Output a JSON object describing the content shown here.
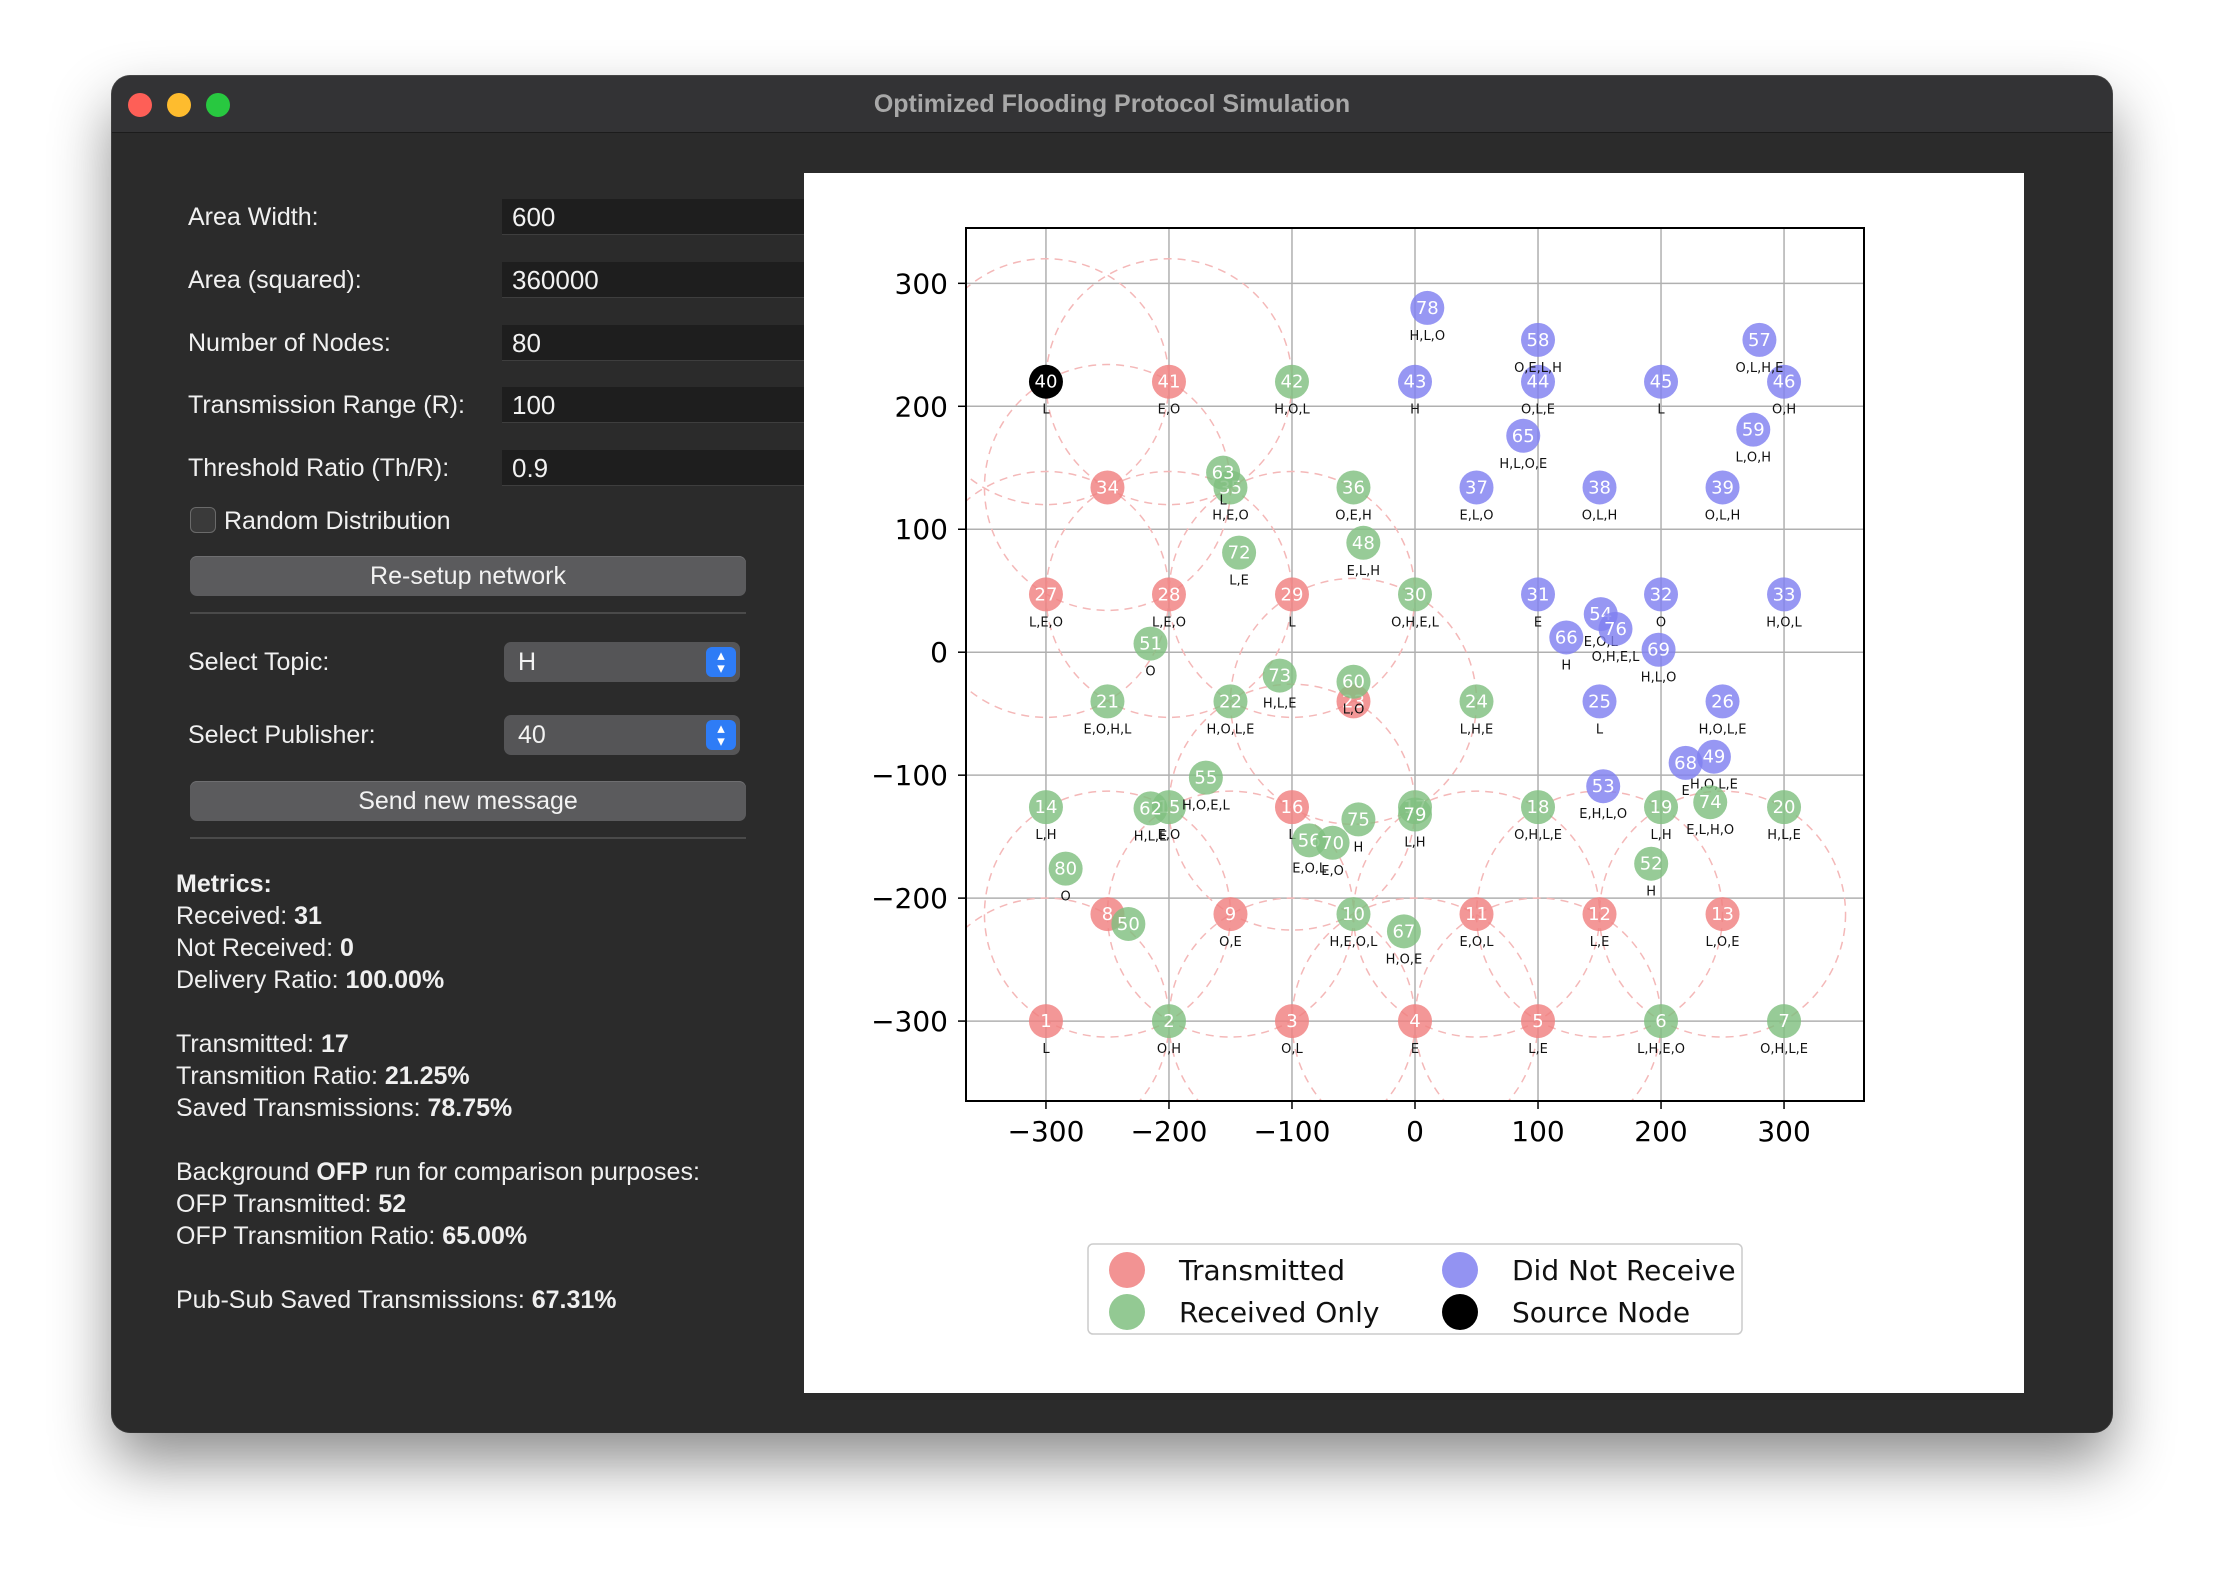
{
  "window": {
    "title": "Optimized Flooding Protocol Simulation"
  },
  "params": [
    {
      "label": "Area Width:",
      "value": "600"
    },
    {
      "label": "Area (squared):",
      "value": "360000"
    },
    {
      "label": "Number of Nodes:",
      "value": "80"
    },
    {
      "label": "Transmission Range (R):",
      "value": "100"
    },
    {
      "label": "Threshold Ratio (Th/R):",
      "value": "0.9"
    }
  ],
  "random_distribution": {
    "label": "Random Distribution",
    "checked": false
  },
  "buttons": {
    "resetup": "Re-setup network",
    "send": "Send new message"
  },
  "topic": {
    "label": "Select Topic:",
    "value": "H"
  },
  "publisher": {
    "label": "Select Publisher:",
    "value": "40"
  },
  "metrics": {
    "heading": "Metrics:",
    "received_label": "Received: ",
    "received": "31",
    "not_received_label": "Not Received: ",
    "not_received": "0",
    "delivery_label": "Delivery Ratio: ",
    "delivery": "100.00%",
    "transmitted_label": "Transmitted: ",
    "transmitted": "17",
    "trans_ratio_label": "Transmition Ratio: ",
    "trans_ratio": "21.25%",
    "saved_label": "Saved Transmissions: ",
    "saved": "78.75%",
    "bg_prefix": "Background ",
    "bg_bold": "OFP",
    "bg_suffix": " run for comparison purposes:",
    "ofp_trans_label": "OFP Transmitted: ",
    "ofp_trans": "52",
    "ofp_ratio_label": "OFP Transmition Ratio: ",
    "ofp_ratio": "65.00%",
    "pubsub_label": "Pub-Sub Saved Transmissions: ",
    "pubsub": "67.31%"
  },
  "chart_data": {
    "type": "scatter",
    "xlim": [
      -365,
      365
    ],
    "ylim": [
      -365,
      345
    ],
    "xticks": [
      -300,
      -200,
      -100,
      0,
      100,
      200,
      300
    ],
    "yticks": [
      -300,
      -200,
      -100,
      0,
      100,
      200,
      300
    ],
    "grid": true,
    "range": 100,
    "legend_position": "bottom",
    "legend": [
      {
        "status": "T",
        "label": "Transmitted",
        "color": "#f08080"
      },
      {
        "status": "R",
        "label": "Received Only",
        "color": "#80c080"
      },
      {
        "status": "N",
        "label": "Did Not Receive",
        "color": "#8080f0"
      },
      {
        "status": "S",
        "label": "Source Node",
        "color": "#000000"
      }
    ],
    "nodes": [
      {
        "id": "1",
        "x": -300,
        "y": -300,
        "s": "T",
        "t": "L"
      },
      {
        "id": "2",
        "x": -200,
        "y": -300,
        "s": "R",
        "t": "O,H"
      },
      {
        "id": "3",
        "x": -100,
        "y": -300,
        "s": "T",
        "t": "O,L"
      },
      {
        "id": "4",
        "x": 0,
        "y": -300,
        "s": "T",
        "t": "E"
      },
      {
        "id": "5",
        "x": 100,
        "y": -300,
        "s": "T",
        "t": "L,E"
      },
      {
        "id": "6",
        "x": 200,
        "y": -300,
        "s": "R",
        "t": "L,H,E,O"
      },
      {
        "id": "7",
        "x": 300,
        "y": -300,
        "s": "R",
        "t": "O,H,L,E"
      },
      {
        "id": "8",
        "x": -250,
        "y": -213,
        "s": "T",
        "t": ""
      },
      {
        "id": "9",
        "x": -150,
        "y": -213,
        "s": "T",
        "t": "O,E"
      },
      {
        "id": "10",
        "x": -50,
        "y": -213,
        "s": "R",
        "t": "H,E,O,L"
      },
      {
        "id": "11",
        "x": 50,
        "y": -213,
        "s": "T",
        "t": "E,O,L"
      },
      {
        "id": "12",
        "x": 150,
        "y": -213,
        "s": "T",
        "t": "L,E"
      },
      {
        "id": "13",
        "x": 250,
        "y": -213,
        "s": "T",
        "t": "L,O,E"
      },
      {
        "id": "14",
        "x": -300,
        "y": -126,
        "s": "R",
        "t": "L,H"
      },
      {
        "id": "15",
        "x": -200,
        "y": -126,
        "s": "R",
        "t": "E,O"
      },
      {
        "id": "16",
        "x": -100,
        "y": -126,
        "s": "T",
        "t": "L"
      },
      {
        "id": "17",
        "x": 0,
        "y": -126,
        "s": "R",
        "t": ""
      },
      {
        "id": "18",
        "x": 100,
        "y": -126,
        "s": "R",
        "t": "O,H,L,E"
      },
      {
        "id": "19",
        "x": 200,
        "y": -126,
        "s": "R",
        "t": "L,H"
      },
      {
        "id": "20",
        "x": 300,
        "y": -126,
        "s": "R",
        "t": "H,L,E"
      },
      {
        "id": "21",
        "x": -250,
        "y": -40,
        "s": "R",
        "t": "E,O,H,L"
      },
      {
        "id": "22",
        "x": -150,
        "y": -40,
        "s": "R",
        "t": "H,O,L,E"
      },
      {
        "id": "23",
        "x": -50,
        "y": -40,
        "s": "T",
        "t": ""
      },
      {
        "id": "24",
        "x": 50,
        "y": -40,
        "s": "R",
        "t": "L,H,E"
      },
      {
        "id": "25",
        "x": 150,
        "y": -40,
        "s": "N",
        "t": "L"
      },
      {
        "id": "26",
        "x": 250,
        "y": -40,
        "s": "N",
        "t": "H,O,L,E"
      },
      {
        "id": "27",
        "x": -300,
        "y": 47,
        "s": "T",
        "t": "L,E,O"
      },
      {
        "id": "28",
        "x": -200,
        "y": 47,
        "s": "T",
        "t": "L,E,O"
      },
      {
        "id": "29",
        "x": -100,
        "y": 47,
        "s": "T",
        "t": "L"
      },
      {
        "id": "30",
        "x": 0,
        "y": 47,
        "s": "R",
        "t": "O,H,E,L"
      },
      {
        "id": "31",
        "x": 100,
        "y": 47,
        "s": "N",
        "t": "E"
      },
      {
        "id": "32",
        "x": 200,
        "y": 47,
        "s": "N",
        "t": "O"
      },
      {
        "id": "33",
        "x": 300,
        "y": 47,
        "s": "N",
        "t": "H,O,L"
      },
      {
        "id": "34",
        "x": -250,
        "y": 134,
        "s": "T",
        "t": ""
      },
      {
        "id": "35",
        "x": -150,
        "y": 134,
        "s": "R",
        "t": "H,E,O"
      },
      {
        "id": "36",
        "x": -50,
        "y": 134,
        "s": "R",
        "t": "O,E,H"
      },
      {
        "id": "37",
        "x": 50,
        "y": 134,
        "s": "N",
        "t": "E,L,O"
      },
      {
        "id": "38",
        "x": 150,
        "y": 134,
        "s": "N",
        "t": "O,L,H"
      },
      {
        "id": "39",
        "x": 250,
        "y": 134,
        "s": "N",
        "t": "O,L,H"
      },
      {
        "id": "40",
        "x": -300,
        "y": 220,
        "s": "S",
        "t": "L"
      },
      {
        "id": "41",
        "x": -200,
        "y": 220,
        "s": "T",
        "t": "E,O"
      },
      {
        "id": "42",
        "x": -100,
        "y": 220,
        "s": "R",
        "t": "H,O,L"
      },
      {
        "id": "43",
        "x": 0,
        "y": 220,
        "s": "N",
        "t": "H"
      },
      {
        "id": "44",
        "x": 100,
        "y": 220,
        "s": "N",
        "t": "O,L,E"
      },
      {
        "id": "45",
        "x": 200,
        "y": 220,
        "s": "N",
        "t": "L"
      },
      {
        "id": "46",
        "x": 300,
        "y": 220,
        "s": "N",
        "t": "O,H"
      },
      {
        "id": "48",
        "x": -42,
        "y": 89,
        "s": "R",
        "t": "E,L,H"
      },
      {
        "id": "49",
        "x": 243,
        "y": -85,
        "s": "N",
        "t": "H,O,L,E"
      },
      {
        "id": "50",
        "x": -233,
        "y": -221,
        "s": "R",
        "t": ""
      },
      {
        "id": "51",
        "x": -215,
        "y": 7,
        "s": "R",
        "t": "O"
      },
      {
        "id": "52",
        "x": 192,
        "y": -172,
        "s": "R",
        "t": "H"
      },
      {
        "id": "53",
        "x": 153,
        "y": -109,
        "s": "N",
        "t": "E,H,L,O"
      },
      {
        "id": "54",
        "x": 151,
        "y": 31,
        "s": "N",
        "t": "E,O,L"
      },
      {
        "id": "55",
        "x": -170,
        "y": -102,
        "s": "R",
        "t": "H,O,E,L"
      },
      {
        "id": "56",
        "x": -86,
        "y": -153,
        "s": "R",
        "t": "E,O,L"
      },
      {
        "id": "57",
        "x": 280,
        "y": 254,
        "s": "N",
        "t": "O,L,H,E"
      },
      {
        "id": "58",
        "x": 100,
        "y": 254,
        "s": "N",
        "t": "O,E,L,H"
      },
      {
        "id": "59",
        "x": 275,
        "y": 181,
        "s": "N",
        "t": "L,O,H"
      },
      {
        "id": "60",
        "x": -50,
        "y": -24,
        "s": "R",
        "t": "L,O"
      },
      {
        "id": "62",
        "x": -215,
        "y": -127,
        "s": "R",
        "t": "H,L,E"
      },
      {
        "id": "63",
        "x": -156,
        "y": 146,
        "s": "R",
        "t": "L"
      },
      {
        "id": "65",
        "x": 88,
        "y": 176,
        "s": "N",
        "t": "H,L,O,E"
      },
      {
        "id": "66",
        "x": 123,
        "y": 12,
        "s": "N",
        "t": "H"
      },
      {
        "id": "67",
        "x": -9,
        "y": -227,
        "s": "R",
        "t": "H,O,E"
      },
      {
        "id": "68",
        "x": 220,
        "y": -90,
        "s": "N",
        "t": "E"
      },
      {
        "id": "69",
        "x": 198,
        "y": 2,
        "s": "N",
        "t": "H,L,O"
      },
      {
        "id": "70",
        "x": -67,
        "y": -155,
        "s": "R",
        "t": "E,O"
      },
      {
        "id": "72",
        "x": -143,
        "y": 81,
        "s": "R",
        "t": "L,E"
      },
      {
        "id": "73",
        "x": -110,
        "y": -19,
        "s": "R",
        "t": "H,L,E"
      },
      {
        "id": "74",
        "x": 240,
        "y": -122,
        "s": "R",
        "t": "E,L,H,O"
      },
      {
        "id": "75",
        "x": -46,
        "y": -136,
        "s": "R",
        "t": "H"
      },
      {
        "id": "76",
        "x": 163,
        "y": 19,
        "s": "N",
        "t": "O,H,E,L"
      },
      {
        "id": "78",
        "x": 10,
        "y": 280,
        "s": "N",
        "t": "H,L,O"
      },
      {
        "id": "79",
        "x": 0,
        "y": -132,
        "s": "R",
        "t": "L,H"
      },
      {
        "id": "80",
        "x": -284,
        "y": -176,
        "s": "R",
        "t": "O"
      }
    ]
  }
}
